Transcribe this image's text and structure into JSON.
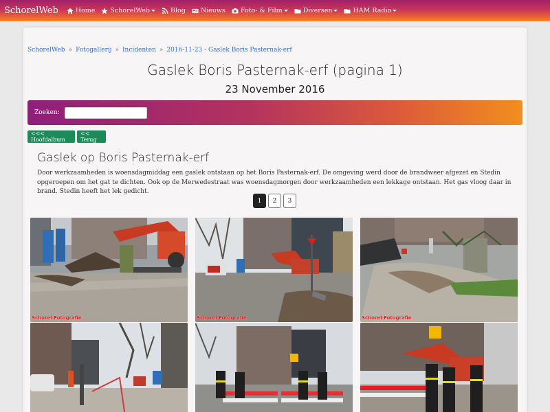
{
  "navbar": {
    "brand": "SchorelWeb",
    "items": [
      {
        "label": "Home",
        "icon": "home-icon",
        "dropdown": false
      },
      {
        "label": "SchorelWeb",
        "icon": "star-icon",
        "dropdown": true
      },
      {
        "label": "Blog",
        "icon": "rss-icon",
        "dropdown": false
      },
      {
        "label": "Nieuws",
        "icon": "newspaper-icon",
        "dropdown": false
      },
      {
        "label": "Foto- & Film",
        "icon": "camera-icon",
        "dropdown": true
      },
      {
        "label": "Diversen",
        "icon": "folder-icon",
        "dropdown": true
      },
      {
        "label": "HAM Radio",
        "icon": "folder-icon",
        "dropdown": true
      }
    ]
  },
  "breadcrumb": [
    "SchorelWeb",
    "Fotogallerij",
    "Incidenten",
    "2016-11-23 - Gaslek Boris Pasternak-erf"
  ],
  "breadcrumb_separator": "»",
  "page": {
    "title": "Gaslek Boris Pasternak-erf (pagina 1)",
    "date": "23 November 2016"
  },
  "search": {
    "label": "Zoeken:",
    "value": ""
  },
  "buttons": {
    "main_album": "<<< Hoofdalbum",
    "back": "<< Terug"
  },
  "album": {
    "title": "Gaslek op Boris Pasternak-erf",
    "description": "Door werkzaamheden is woensdagmiddag een gaslek ontstaan op het Boris Pasternak-erf. De omgeving werd door de brandweer afgezet en Stedin opgeroepen om het gat te dichten. Ook op de Merwedestraat was woensdagmorgen door werkzaamheden een lekkage ontstaan. Het gas vloog daar in brand. Stedin heeft het lek gedicht."
  },
  "pagination": {
    "pages": [
      "1",
      "2",
      "3"
    ],
    "active": "1"
  },
  "photos": [
    {
      "alt": "excavator-site-photo",
      "watermark": "Schorel Fotografie"
    },
    {
      "alt": "excavator-street-photo",
      "watermark": "Schorel Fotografie"
    },
    {
      "alt": "dug-up-garden-photo",
      "watermark": "Schorel Fotografie"
    },
    {
      "alt": "street-cordon-photo",
      "watermark": ""
    },
    {
      "alt": "firefighters-barrier-photo",
      "watermark": ""
    },
    {
      "alt": "firefighters-excavator-photo",
      "watermark": ""
    }
  ],
  "colors": {
    "nav_start": "#a0206a",
    "nav_end": "#f28a26",
    "button_green": "#1d8a5a",
    "link": "#3a6fd1"
  }
}
